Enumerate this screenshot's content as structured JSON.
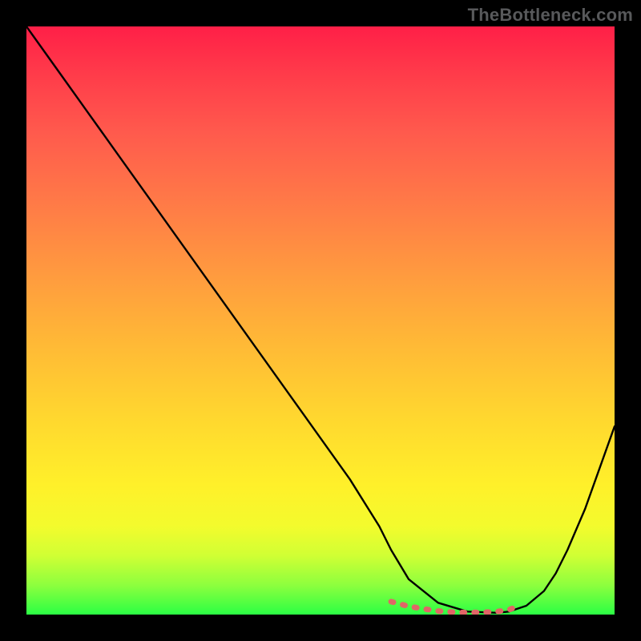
{
  "watermark": "TheBottleneck.com",
  "colors": {
    "page_bg": "#000000",
    "curve": "#000000",
    "accent_marker": "#e06666",
    "gradient_top": "#ff1f47",
    "gradient_bottom": "#2bff44"
  },
  "chart_data": {
    "type": "line",
    "title": "",
    "xlabel": "",
    "ylabel": "",
    "xlim": [
      0,
      100
    ],
    "ylim": [
      0,
      100
    ],
    "grid": false,
    "legend": false,
    "series": [
      {
        "name": "curve",
        "x": [
          0,
          5,
          10,
          15,
          20,
          25,
          30,
          35,
          40,
          45,
          50,
          55,
          60,
          62,
          65,
          70,
          75,
          80,
          82,
          85,
          88,
          90,
          92,
          95,
          100
        ],
        "values": [
          100,
          93,
          86,
          79,
          72,
          65,
          58,
          51,
          44,
          37,
          30,
          23,
          15,
          11,
          6,
          2,
          0.5,
          0.3,
          0.5,
          1.5,
          4,
          7,
          11,
          18,
          32
        ]
      }
    ],
    "marker_region": {
      "x": [
        62,
        65,
        68,
        70,
        72,
        74,
        76,
        78,
        80,
        82,
        84
      ],
      "values": [
        2.2,
        1.4,
        0.9,
        0.6,
        0.45,
        0.35,
        0.35,
        0.4,
        0.5,
        0.8,
        1.6
      ]
    }
  }
}
